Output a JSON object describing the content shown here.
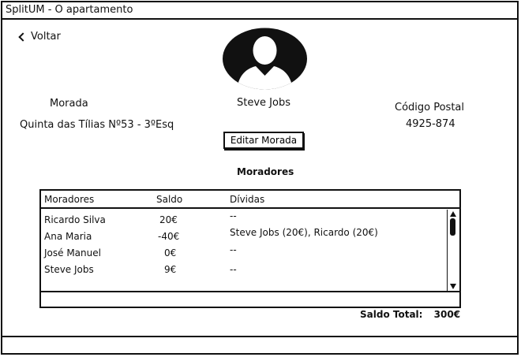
{
  "window": {
    "title": "SplitUM - O apartamento"
  },
  "nav": {
    "back_label": "Voltar"
  },
  "profile": {
    "name": "Steve Jobs",
    "avatar_icon": "user-avatar-icon"
  },
  "address": {
    "label": "Morada",
    "value": "Quinta das Tílias Nº53 - 3ºEsq",
    "edit_label": "Editar Morada"
  },
  "postal": {
    "label": "Código Postal",
    "value": "4925-874"
  },
  "residents": {
    "section_title": "Moradores",
    "columns": [
      "Moradores",
      "Saldo",
      "Dívidas"
    ],
    "rows": [
      {
        "name": "Ricardo Silva",
        "saldo": "20€",
        "dividas": "--"
      },
      {
        "name": "Ana Maria",
        "saldo": "-40€",
        "dividas": "Steve Jobs (20€), Ricardo (20€)"
      },
      {
        "name": "José Manuel",
        "saldo": "0€",
        "dividas": "--"
      },
      {
        "name": "Steve Jobs",
        "saldo": "9€",
        "dividas": "--"
      }
    ]
  },
  "summary": {
    "label": "Saldo Total:",
    "value": "300€"
  }
}
